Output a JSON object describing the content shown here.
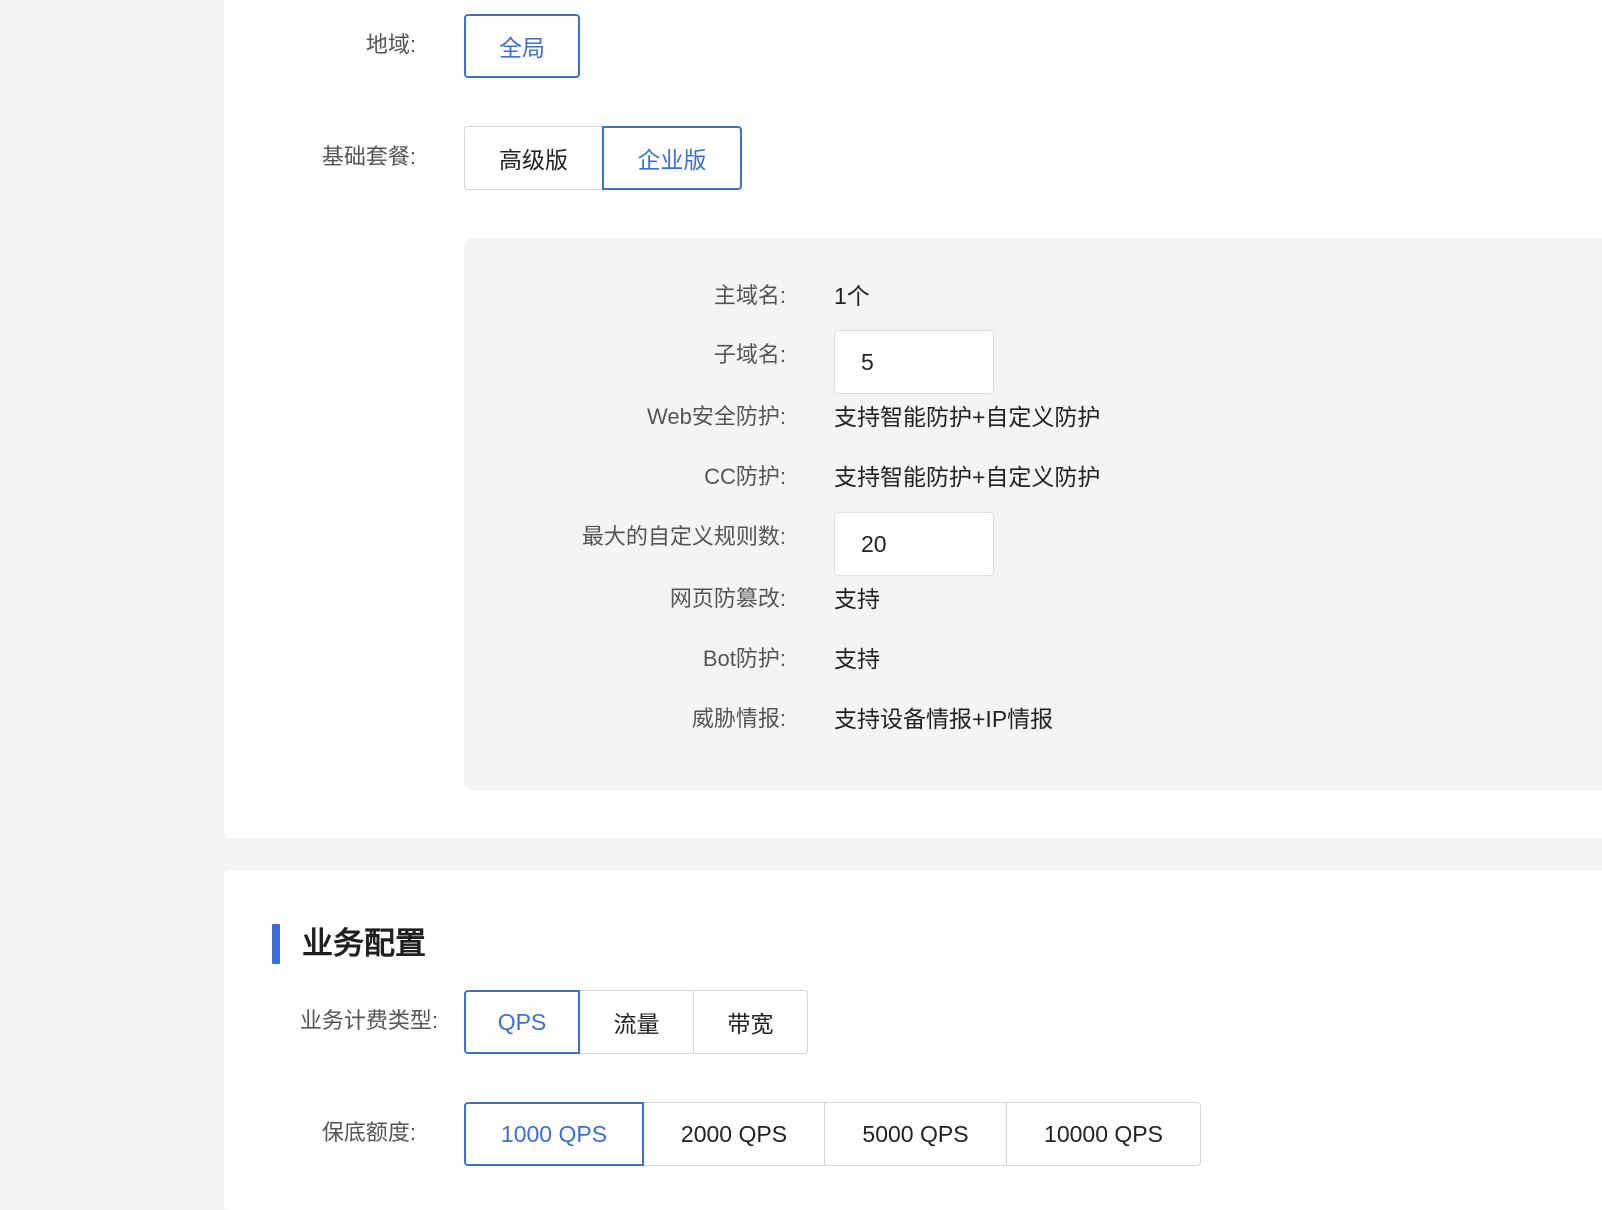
{
  "region": {
    "label": "地域:",
    "options": [
      "全局"
    ],
    "selected": "全局"
  },
  "base_package": {
    "label": "基础套餐:",
    "options": [
      "高级版",
      "企业版"
    ],
    "selected": "企业版"
  },
  "package_details": {
    "main_domain": {
      "label": "主域名:",
      "value": "1个"
    },
    "sub_domain": {
      "label": "子域名:",
      "value": "5"
    },
    "web_protection": {
      "label": "Web安全防护:",
      "value": "支持智能防护+自定义防护"
    },
    "cc_protection": {
      "label": "CC防护:",
      "value": "支持智能防护+自定义防护"
    },
    "max_custom_rules": {
      "label": "最大的自定义规则数:",
      "value": "20"
    },
    "tamper_protection": {
      "label": "网页防篡改:",
      "value": "支持"
    },
    "bot_protection": {
      "label": "Bot防护:",
      "value": "支持"
    },
    "threat_intel": {
      "label": "威胁情报:",
      "value": "支持设备情报+IP情报"
    }
  },
  "business_config": {
    "title": "业务配置",
    "billing_type": {
      "label": "业务计费类型:",
      "options": [
        "QPS",
        "流量",
        "带宽"
      ],
      "selected": "QPS"
    },
    "guaranteed_quota": {
      "label": "保底额度:",
      "options": [
        "1000 QPS",
        "2000 QPS",
        "5000 QPS",
        "10000 QPS"
      ],
      "selected": "1000 QPS"
    }
  },
  "colors": {
    "accent": "#3b6fd8",
    "background": "#f3f4f6",
    "card": "#ffffff"
  }
}
